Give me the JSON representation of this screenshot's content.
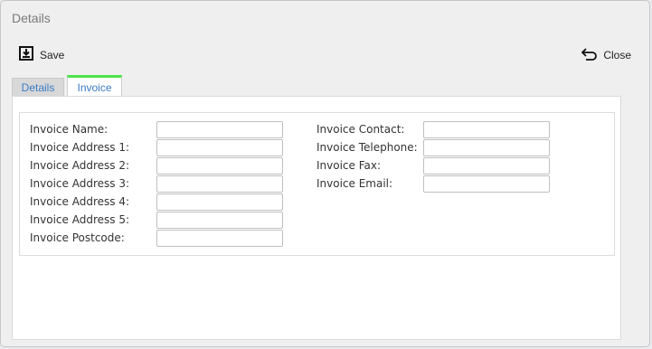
{
  "dialog": {
    "title": "Details"
  },
  "toolbar": {
    "save_label": "Save",
    "close_label": "Close"
  },
  "tabs": [
    {
      "label": "Details",
      "active": false
    },
    {
      "label": "Invoice",
      "active": true
    }
  ],
  "form": {
    "left_fields": [
      {
        "label": "Invoice Name:",
        "value": ""
      },
      {
        "label": "Invoice Address 1:",
        "value": ""
      },
      {
        "label": "Invoice Address 2:",
        "value": ""
      },
      {
        "label": "Invoice Address 3:",
        "value": ""
      },
      {
        "label": "Invoice Address 4:",
        "value": ""
      },
      {
        "label": "Invoice Address 5:",
        "value": ""
      },
      {
        "label": "Invoice Postcode:",
        "value": ""
      }
    ],
    "right_fields": [
      {
        "label": "Invoice Contact:",
        "value": ""
      },
      {
        "label": "Invoice Telephone:",
        "value": ""
      },
      {
        "label": "Invoice Fax:",
        "value": ""
      },
      {
        "label": "Invoice Email:",
        "value": ""
      }
    ]
  },
  "colors": {
    "active_tab_accent": "#4de24d",
    "tab_text": "#3a7bc8",
    "dialog_bg": "#efefef"
  }
}
